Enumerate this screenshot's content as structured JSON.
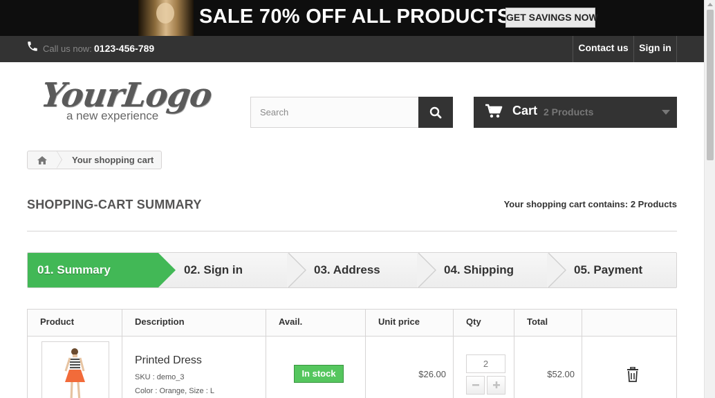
{
  "banner": {
    "headline": "SALE 70% OFF ALL PRODUCTS",
    "button_label": "GET SAVINGS NOW"
  },
  "nav": {
    "call_label": "Call us now:",
    "phone": "0123-456-789",
    "contact_label": "Contact us",
    "signin_label": "Sign in"
  },
  "logo": {
    "main": "YourLogo",
    "tagline": "a new experience"
  },
  "search": {
    "placeholder": "Search"
  },
  "cart": {
    "label": "Cart",
    "count": "2 Products"
  },
  "breadcrumb": {
    "current": "Your shopping cart"
  },
  "heading": {
    "title": "Shopping-cart summary",
    "contains_prefix": "Your shopping cart contains:",
    "contains_count": "2 Products"
  },
  "steps": [
    {
      "label": "01. Summary",
      "active": true
    },
    {
      "label": "02. Sign in",
      "active": false
    },
    {
      "label": "03. Address",
      "active": false
    },
    {
      "label": "04. Shipping",
      "active": false
    },
    {
      "label": "05. Payment",
      "active": false
    }
  ],
  "table": {
    "headers": [
      "Product",
      "Description",
      "Avail.",
      "Unit price",
      "Qty",
      "Total",
      ""
    ],
    "rows": [
      {
        "name": "Printed Dress",
        "sku": "SKU : demo_3",
        "attributes": "Color : Orange, Size : L",
        "availability": "In stock",
        "unit_price": "$26.00",
        "qty": "2",
        "total": "$52.00"
      }
    ]
  },
  "colors": {
    "active_step": "#42b856",
    "stock_badge": "#55c65e",
    "dark": "#333333"
  },
  "icons": [
    "phone-icon",
    "search-icon",
    "cart-icon",
    "home-icon",
    "minus-icon",
    "plus-icon",
    "trash-icon"
  ]
}
